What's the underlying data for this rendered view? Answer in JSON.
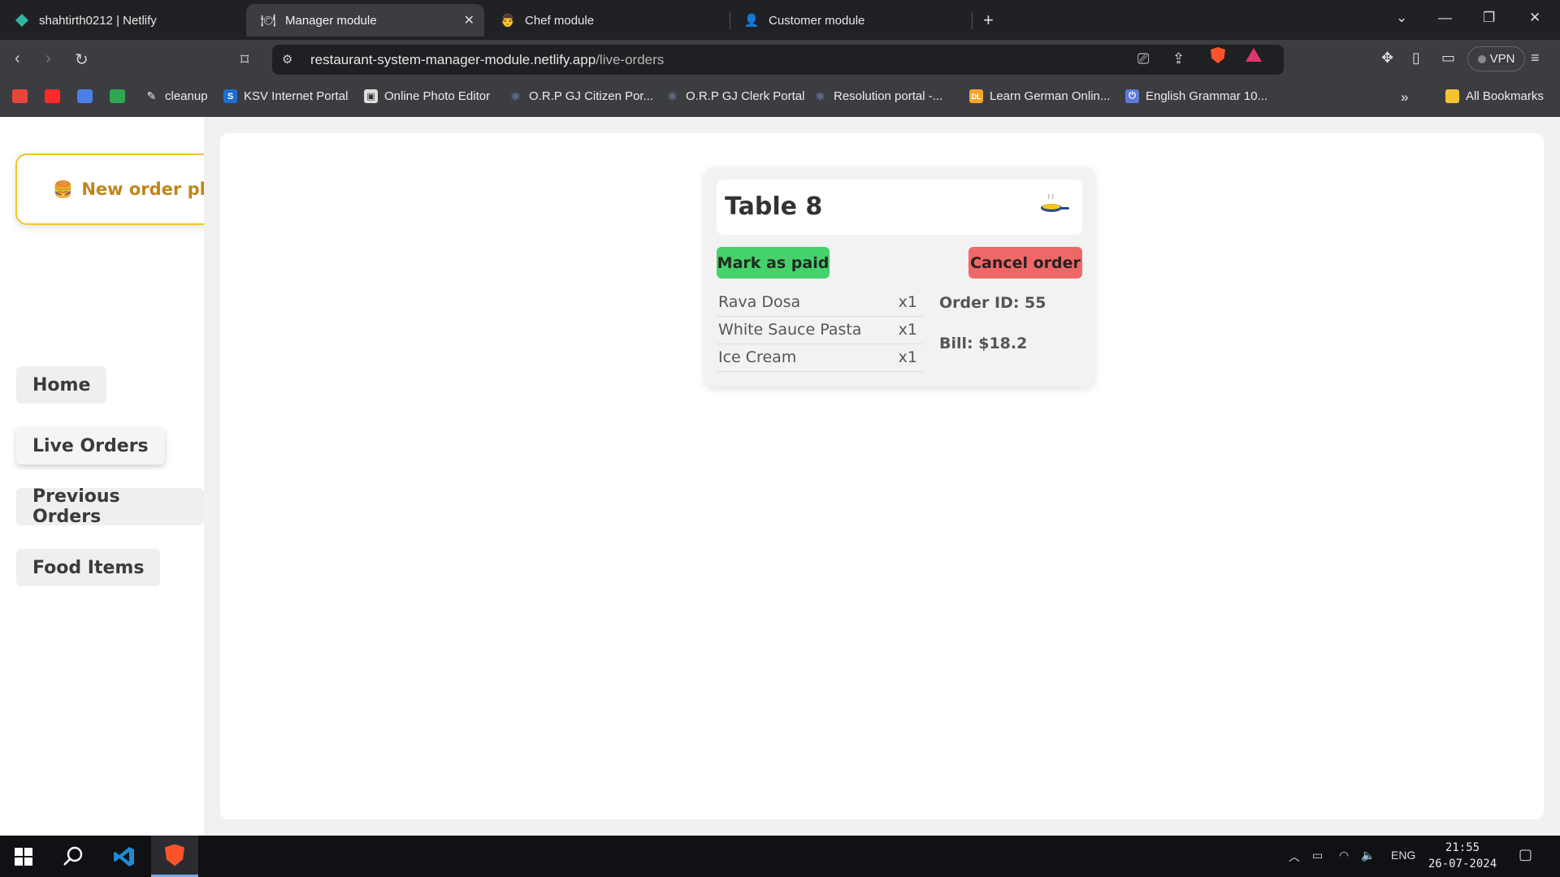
{
  "browser": {
    "tabs": [
      {
        "title": "shahtirth0212 | Netlify",
        "active": false
      },
      {
        "title": "Manager module",
        "active": true
      },
      {
        "title": "Chef module",
        "active": false
      },
      {
        "title": "Customer module",
        "active": false
      }
    ],
    "url_host": "restaurant-system-manager-module.netlify.app",
    "url_path": "/live-orders",
    "vpn_label": "VPN",
    "bookmarks": [
      {
        "label": "cleanup"
      },
      {
        "label": "KSV Internet Portal"
      },
      {
        "label": "Online Photo Editor"
      },
      {
        "label": "O.R.P GJ Citizen Por..."
      },
      {
        "label": "O.R.P GJ Clerk Portal"
      },
      {
        "label": "Resolution portal -..."
      },
      {
        "label": "Learn German Onlin..."
      },
      {
        "label": "English Grammar 10..."
      }
    ],
    "all_bookmarks_label": "All Bookmarks"
  },
  "toast": {
    "message": "New order placed !"
  },
  "sidebar": {
    "items": [
      {
        "label": "Home"
      },
      {
        "label": "Live Orders"
      },
      {
        "label": "Previous Orders"
      },
      {
        "label": "Food Items"
      }
    ]
  },
  "order": {
    "table": "Table 8",
    "mark_paid_label": "Mark as paid",
    "cancel_label": "Cancel order",
    "items": [
      {
        "name": "Rava Dosa",
        "qty": "x1"
      },
      {
        "name": "White Sauce Pasta",
        "qty": "x1"
      },
      {
        "name": "Ice Cream",
        "qty": "x1"
      }
    ],
    "order_id_text": "Order ID: 55",
    "bill_text": "Bill: $18.2"
  },
  "taskbar": {
    "lang": "ENG",
    "time": "21:55",
    "date": "26-07-2024"
  },
  "colors": {
    "paid_button": "#46d26b",
    "cancel_button": "#ef6868",
    "toast_border": "#f3c623",
    "toast_text": "#c0861b"
  }
}
